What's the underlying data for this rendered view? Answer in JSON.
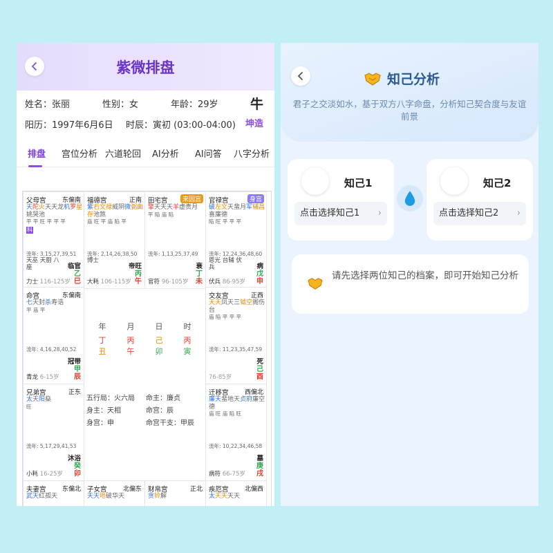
{
  "left": {
    "title": "紫微排盘",
    "info": {
      "name": "姓名：张丽",
      "gender": "性别：女",
      "age": "年龄：29岁",
      "zodiac": "牛",
      "solar": "阳历：1997年6月6日",
      "hour": "时辰：寅初 (03:00-04:00)",
      "switch_label": "坤造"
    },
    "tabs": [
      "排盘",
      "宫位分析",
      "六道轮回",
      "AI分析",
      "AI问答",
      "八字分析"
    ],
    "palaces": [
      {
        "name": "父母宫",
        "dir": "东偏南",
        "stars": [
          [
            "天",
            "s-blue"
          ],
          [
            "陀",
            "s-red"
          ],
          [
            "火",
            "s-org"
          ],
          [
            "天",
            "s-gry"
          ],
          [
            "天",
            "s-gry"
          ],
          [
            "龙",
            "s-gry"
          ],
          [
            "机",
            "s-blue"
          ],
          [
            "罗",
            "s-red"
          ],
          [
            "星",
            "s-org"
          ],
          [
            "姚",
            "s-gry"
          ],
          [
            "哭",
            "s-gry"
          ],
          [
            "池",
            "s-gry"
          ]
        ],
        "bright": "平 平 旺 平 平 平",
        "hua": "科",
        "liu": "流年: 3,15,27,39,51",
        "sub": "天巫 天厨 八座",
        "boss": "力士",
        "age": "116-125岁",
        "state": "临官",
        "gan": "乙",
        "zhi": "巳"
      },
      {
        "name": "福德宫",
        "dir": "正南",
        "stars": [
          [
            "紫",
            "s-blue"
          ],
          [
            "右",
            "s-org"
          ],
          [
            "文",
            "s-org"
          ],
          [
            "禄",
            "s-org"
          ],
          [
            "威",
            "s-gry"
          ],
          [
            "阴",
            "s-gry"
          ],
          [
            "微",
            "s-blue"
          ],
          [
            "弼",
            "s-org"
          ],
          [
            "曲",
            "s-org"
          ],
          [
            "存",
            "s-org"
          ],
          [
            "池",
            "s-gry"
          ],
          [
            "煞",
            "s-gry"
          ]
        ],
        "bright": "庙 旺 平 庙 陷 平",
        "liu": "流年: 2,14,26,38,50",
        "sub": "博士",
        "boss": "大耗",
        "age": "106-115岁",
        "state": "帝旺",
        "gan": "丙",
        "zhi": "午"
      },
      {
        "name": "田宅宫",
        "tag": "来因宫",
        "tagcolor": "#e89a1a",
        "stars": [
          [
            "擎",
            "s-red"
          ],
          [
            "天",
            "s-gry"
          ],
          [
            "天",
            "s-gry"
          ],
          [
            "天",
            "s-gry"
          ],
          [
            "羊",
            "s-red"
          ],
          [
            "虚",
            "s-gry"
          ],
          [
            "贵",
            "s-gry"
          ],
          [
            "月",
            "s-gry"
          ]
        ],
        "bright": "平 陷 庙 陷",
        "liu": "流年: 1,13,25,37,49",
        "sub": "",
        "boss": "官符",
        "age": "96-105岁",
        "state": "衰",
        "gan": "丁",
        "zhi": "未"
      },
      {
        "name": "官禄宫",
        "tag": "身宫",
        "tagcolor": "#8b7df0",
        "stars": [
          [
            "破",
            "s-blue"
          ],
          [
            "左",
            "s-org"
          ],
          [
            "文",
            "s-org"
          ],
          [
            "天",
            "s-gry"
          ],
          [
            "蜚",
            "s-gry"
          ],
          [
            "月",
            "s-gry"
          ],
          [
            "军",
            "s-blue"
          ],
          [
            "辅",
            "s-org"
          ],
          [
            "昌",
            "s-org"
          ],
          [
            "喜",
            "s-gry"
          ],
          [
            "廉",
            "s-gry"
          ],
          [
            "德",
            "s-gry"
          ]
        ],
        "bright": "陷 旺 平 平 平",
        "liu": "流年: 12,24,36,48,60",
        "sub": "恩光 台辅 伏兵",
        "boss": "伏兵",
        "age": "86-95岁",
        "state": "病",
        "gan": "戊",
        "zhi": "申"
      },
      {
        "name": "命宫",
        "dir": "东偏南",
        "stars": [
          [
            "七",
            "s-blue"
          ],
          [
            "天",
            "s-gry"
          ],
          [
            "封",
            "s-gry"
          ],
          [
            "杀",
            "s-blue"
          ],
          [
            "寿",
            "s-gry"
          ],
          [
            "诰",
            "s-gry"
          ]
        ],
        "bright": "平 庙 平",
        "liu": "流年: 4,16,28,40,52",
        "sub": "",
        "boss": "青龙",
        "age": "6-15岁",
        "state": "冠带",
        "gan": "甲",
        "zhi": "辰"
      },
      {
        "name": "交友宫",
        "dir": "正西",
        "stars": [
          [
            "天",
            "s-org"
          ],
          [
            "天",
            "s-org"
          ],
          [
            "凤",
            "s-gry"
          ],
          [
            "天",
            "s-gry"
          ],
          [
            "三",
            "s-gry"
          ],
          [
            "钺",
            "s-org"
          ],
          [
            "空",
            "s-org"
          ],
          [
            "阁",
            "s-gry"
          ],
          [
            "伤",
            "s-gry"
          ],
          [
            "台",
            "s-gry"
          ]
        ],
        "bright": "庙 陷 平 平 平",
        "liu": "流年: 11,23,35,47,59",
        "sub": "",
        "boss": "",
        "age": "76-85岁",
        "state": "死",
        "gan": "己",
        "zhi": "酉"
      },
      {
        "name": "兄弟宫",
        "dir": "正东",
        "stars": [
          [
            "太",
            "s-blue"
          ],
          [
            "天",
            "s-gry"
          ],
          [
            "阳",
            "s-blue"
          ],
          [
            "燊",
            "s-gry"
          ]
        ],
        "bright": "旺",
        "liu": "流年: 5,17,29,41,53",
        "sub": "",
        "boss": "小耗",
        "age": "16-25岁",
        "state": "沐浴",
        "gan": "癸",
        "zhi": "卯"
      },
      {
        "name": "迁移宫",
        "dir": "西偏北",
        "stars": [
          [
            "廉",
            "s-blue"
          ],
          [
            "天",
            "s-blue"
          ],
          [
            "蜚",
            "s-gry"
          ],
          [
            "地",
            "s-gry"
          ],
          [
            "天",
            "s-gry"
          ],
          [
            "贞",
            "s-blue"
          ],
          [
            "府",
            "s-blue"
          ],
          [
            "廉",
            "s-gry"
          ],
          [
            "空",
            "s-gry"
          ],
          [
            "德",
            "s-gry"
          ]
        ],
        "bright": "庙 旺 庙 陷 旺",
        "liu": "流年: 10,22,34,46,58",
        "sub": "",
        "boss": "病符",
        "age": "66-75岁",
        "state": "墓",
        "gan": "庚",
        "zhi": "戌"
      },
      {
        "name": "夫妻宫",
        "dir": "东偏北",
        "stars": [
          [
            "武",
            "s-blue"
          ],
          [
            "天",
            "s-blue"
          ],
          [
            "红",
            "s-gry"
          ],
          [
            "孤",
            "s-gry"
          ],
          [
            "天",
            "s-gry"
          ]
        ],
        "bright": "",
        "liu": "",
        "sub": "",
        "boss": "",
        "age": "",
        "state": "",
        "gan": "",
        "zhi": ""
      },
      {
        "name": "子女宫",
        "dir": "北偏东",
        "stars": [
          [
            "天",
            "s-blue"
          ],
          [
            "天",
            "s-blue"
          ],
          [
            "地",
            "s-org"
          ],
          [
            "破",
            "s-gry"
          ],
          [
            "华",
            "s-gry"
          ],
          [
            "天",
            "s-gry"
          ]
        ],
        "bright": "",
        "liu": "",
        "sub": "",
        "boss": "",
        "age": "",
        "state": "",
        "gan": "",
        "zhi": ""
      },
      {
        "name": "财帛宫",
        "dir": "正北",
        "stars": [
          [
            "贪",
            "s-blue"
          ],
          [
            "铃",
            "s-org"
          ],
          [
            "解",
            "s-gry"
          ]
        ],
        "bright": "",
        "liu": "",
        "sub": "",
        "boss": "",
        "age": "",
        "state": "",
        "gan": "",
        "zhi": ""
      },
      {
        "name": "疾厄宫",
        "dir": "北偏西",
        "stars": [
          [
            "太",
            "s-blue"
          ],
          [
            "天",
            "s-org"
          ],
          [
            "天",
            "s-org"
          ],
          [
            "天",
            "s-gry"
          ],
          [
            "天",
            "s-gry"
          ]
        ],
        "bright": "",
        "liu": "",
        "sub": "",
        "boss": "",
        "age": "",
        "state": "",
        "gan": "",
        "zhi": ""
      }
    ],
    "center": {
      "cols": [
        {
          "h": "年",
          "g": "丁",
          "z": "丑",
          "gc": "#e0402f",
          "zc": "#e68a00"
        },
        {
          "h": "月",
          "g": "丙",
          "z": "午",
          "gc": "#e0402f",
          "zc": "#e0402f"
        },
        {
          "h": "日",
          "g": "己",
          "z": "卯",
          "gc": "#e68a00",
          "zc": "#2fa84f"
        },
        {
          "h": "时",
          "g": "丙",
          "z": "寅",
          "gc": "#e0402f",
          "zc": "#2fa84f"
        }
      ],
      "wuxing": "五行局：火六局",
      "mingzhu": "命主：廉贞",
      "shenzhu": "身主：天相",
      "minggong": "命宫：辰",
      "shengong": "身宫：申",
      "minggan": "命宫干支：甲辰"
    }
  },
  "right": {
    "title": "知己分析",
    "subtitle": "君子之交淡如水，基于双方八字命盘，分析知己契合度与友谊前景",
    "k1_name": "知己1",
    "k1_pick": "点击选择知己1",
    "k2_name": "知己2",
    "k2_pick": "点击选择知己2",
    "tip": "请先选择两位知己的档案，即可开始知己分析"
  }
}
